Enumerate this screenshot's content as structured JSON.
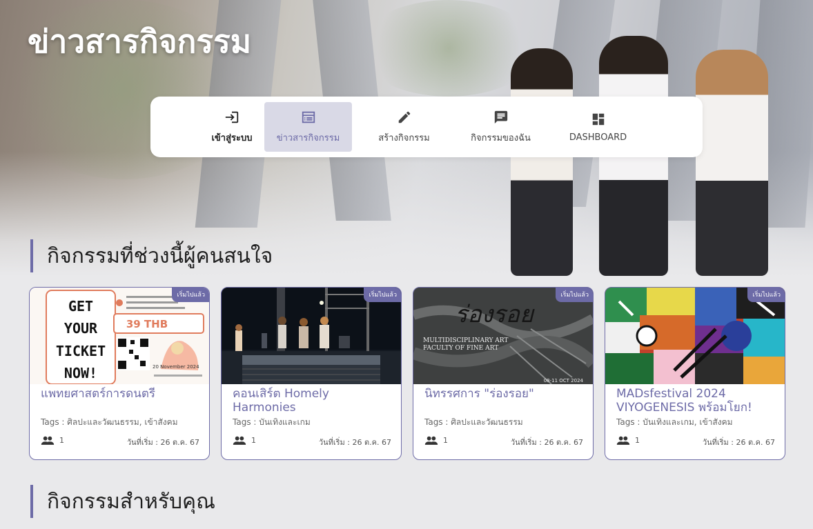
{
  "page": {
    "title": "ข่าวสารกิจกรรม"
  },
  "nav": {
    "items": [
      {
        "label": "เข้าสู่ระบบ",
        "icon": "login-icon"
      },
      {
        "label": "ข่าวสารกิจกรรม",
        "icon": "calendar-icon",
        "active": true
      },
      {
        "label": "สร้างกิจกรรม",
        "icon": "pencil-icon"
      },
      {
        "label": "กิจกรรมของฉัน",
        "icon": "chat-icon"
      },
      {
        "label": "DASHBOARD",
        "icon": "dashboard-icon"
      }
    ]
  },
  "sections": {
    "popular": "กิจกรรมที่ช่วงนี้ผู้คนสนใจ",
    "for_you": "กิจกรรมสำหรับคุณ"
  },
  "cards": [
    {
      "badge": "เริ่มไปแล้ว",
      "title": "แพทยศาสตร์การดนตรี",
      "tags": "Tags : ศิลปะและวัฒนธรรม, เข้าสังคม",
      "people": "1",
      "start": "วันที่เริ่ม : 26 ต.ค. 67",
      "image_text": {
        "line1": "GET",
        "line2": "YOUR",
        "line3": "TICKET",
        "line4": "NOW!",
        "price": "39 THB",
        "date": "20 November 2024"
      }
    },
    {
      "badge": "เริ่มไปแล้ว",
      "title": "คอนเสิร์ต Homely Harmonies",
      "tags": "Tags : บันเทิงและเกม",
      "people": "1",
      "start": "วันที่เริ่ม : 26 ต.ค. 67"
    },
    {
      "badge": "เริ่มไปแล้ว",
      "title": "นิทรรศการ \"ร่องรอย\"",
      "tags": "Tags : ศิลปะและวัฒนธรรม",
      "people": "1",
      "start": "วันที่เริ่ม : 26 ต.ค. 67",
      "image_text": {
        "headline": "ร่องรอย",
        "line1": "MULTIDISCIPLINARY ART",
        "line2": "FACULTY OF FINE ART",
        "date": "08-11 OCT 2024"
      }
    },
    {
      "badge": "เริ่มไปแล้ว",
      "title": "MADsfestival 2024 VIYOGENESIS พร้อมโยก!",
      "tags": "Tags : บันเทิงและเกม, เข้าสังคม",
      "people": "1",
      "start": "วันที่เริ่ม : 26 ต.ค. 67"
    }
  ],
  "colors": {
    "accent": "#6d6ba7",
    "nav_active_bg": "#d9d9e6",
    "page_bg": "#e9e9eb"
  }
}
